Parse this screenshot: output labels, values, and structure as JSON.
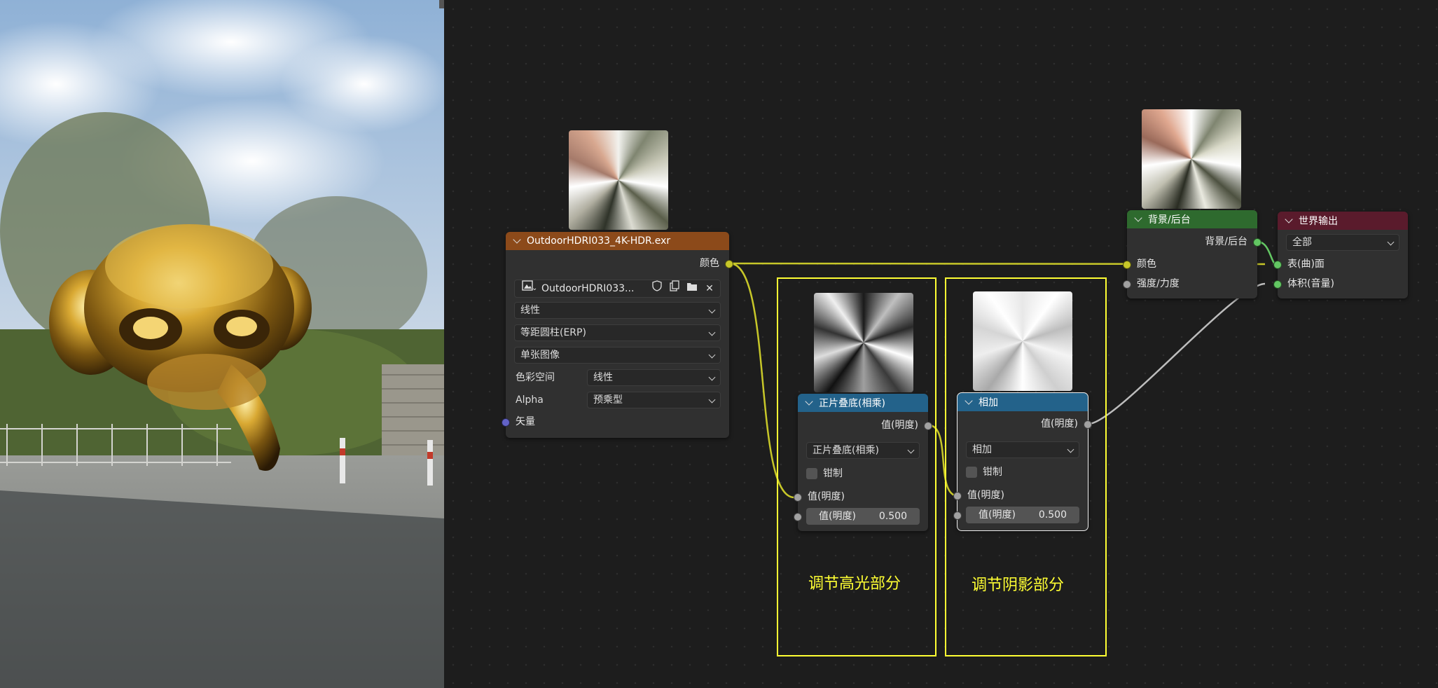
{
  "image_node": {
    "title": "OutdoorHDRI033_4K-HDR.exr",
    "output_color": "颜色",
    "image_name": "OutdoorHDRI033...",
    "interpolation": "线性",
    "projection": "等距圆柱(ERP)",
    "source": "单张图像",
    "colorspace_label": "色彩空间",
    "colorspace_value": "线性",
    "alpha_label": "Alpha",
    "alpha_value": "预乘型",
    "vector_input": "矢量"
  },
  "multiply_node": {
    "title": "正片叠底(相乘)",
    "output": "值(明度)",
    "operation": "正片叠底(相乘)",
    "clamp": "钳制",
    "input1": "值(明度)",
    "input2_label": "值(明度)",
    "input2_value": "0.500"
  },
  "add_node": {
    "title": "相加",
    "output": "值(明度)",
    "operation": "相加",
    "clamp": "钳制",
    "input1": "值(明度)",
    "input2_label": "值(明度)",
    "input2_value": "0.500"
  },
  "background_node": {
    "title": "背景/后台",
    "output": "背景/后台",
    "input_color": "颜色",
    "input_strength": "强度/力度"
  },
  "world_output_node": {
    "title": "世界输出",
    "target": "全部",
    "input_surface": "表(曲)面",
    "input_volume": "体积(音量)"
  },
  "annotations": {
    "highlight": "调节高光部分",
    "shadow": "调节阴影部分"
  },
  "colors": {
    "image_header": "#8c4a1a",
    "math_header": "#23628a",
    "shader_header": "#2e6a2e",
    "output_header": "#5a1b2c",
    "annotation": "#ffff33",
    "color_socket": "#c7c729",
    "float_socket": "#a1a1a1",
    "vector_socket": "#6363c7",
    "shader_socket": "#63c763"
  },
  "icons": [
    "image-icon",
    "shield-icon",
    "duplicate-icon",
    "folder-icon",
    "close-icon",
    "chevron-down-icon"
  ]
}
